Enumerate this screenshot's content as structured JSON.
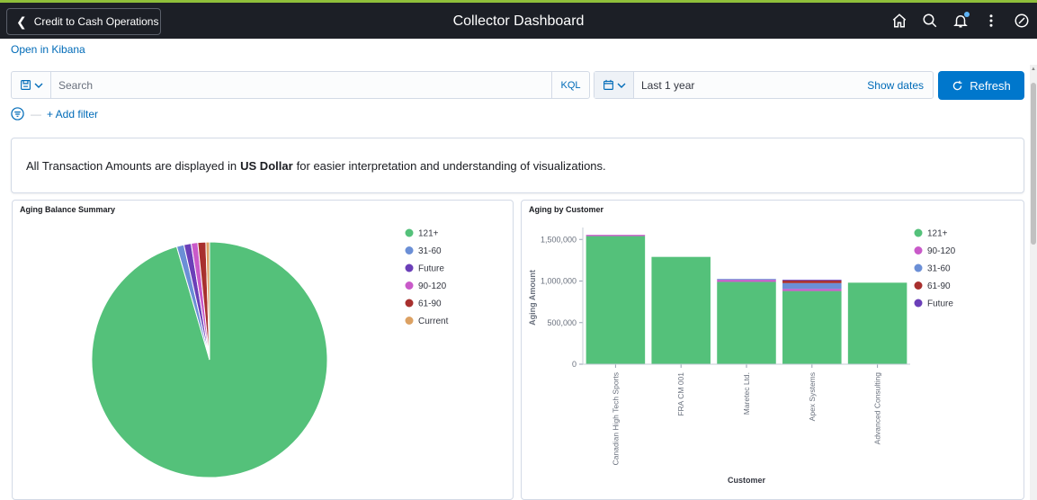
{
  "header": {
    "back_label": "Credit to Cash Operations",
    "title": "Collector Dashboard",
    "icons": [
      "home-icon",
      "search-icon",
      "bell-icon",
      "more-vertical-icon",
      "compass-icon"
    ]
  },
  "kibana_link": "Open in Kibana",
  "query_bar": {
    "search_placeholder": "Search",
    "kql_label": "KQL",
    "date_value": "Last 1 year",
    "show_dates_label": "Show dates",
    "refresh_label": "Refresh",
    "add_filter_label": "+ Add filter"
  },
  "notice": {
    "prefix": "All Transaction Amounts are displayed in",
    "currency": "US Dollar",
    "suffix": "for easier interpretation and understanding of visualizations."
  },
  "colors": {
    "121+": "#54c17a",
    "31-60": "#6b8fd6",
    "Future": "#6b3fb8",
    "90-120": "#c95ac9",
    "61-90": "#a8302e",
    "Current": "#dca163"
  },
  "chart_data": [
    {
      "type": "pie",
      "title": "Aging Balance Summary",
      "legend": [
        "121+",
        "31-60",
        "Future",
        "90-120",
        "61-90",
        "Current"
      ],
      "legend_position": "right",
      "slices": [
        {
          "label": "121+",
          "value": 95.5
        },
        {
          "label": "31-60",
          "value": 1.0
        },
        {
          "label": "Future",
          "value": 1.0
        },
        {
          "label": "90-120",
          "value": 0.9
        },
        {
          "label": "61-90",
          "value": 1.1
        },
        {
          "label": "Current",
          "value": 0.5
        }
      ]
    },
    {
      "type": "bar",
      "stacked": true,
      "title": "Aging by Customer",
      "xlabel": "Customer",
      "ylabel": "Aging Amount",
      "ylim": [
        0,
        1600000
      ],
      "y_ticks": [
        0,
        500000,
        1000000,
        1500000
      ],
      "y_tick_labels": [
        "0",
        "500,000",
        "1,000,000",
        "1,500,000"
      ],
      "categories": [
        "Canadian High Tech Sports",
        "FRA CM 001",
        "Maretec Ltd.",
        "Apex Systems",
        "Advanced Consulting"
      ],
      "legend": [
        "121+",
        "90-120",
        "31-60",
        "61-90",
        "Future"
      ],
      "legend_position": "right",
      "series": [
        {
          "name": "121+",
          "values": [
            1540000,
            1290000,
            990000,
            880000,
            980000
          ]
        },
        {
          "name": "90-120",
          "values": [
            15000,
            0,
            25000,
            25000,
            0
          ]
        },
        {
          "name": "31-60",
          "values": [
            0,
            0,
            10000,
            70000,
            0
          ]
        },
        {
          "name": "61-90",
          "values": [
            0,
            0,
            0,
            30000,
            0
          ]
        },
        {
          "name": "Future",
          "values": [
            0,
            0,
            0,
            10000,
            0
          ]
        }
      ]
    }
  ]
}
